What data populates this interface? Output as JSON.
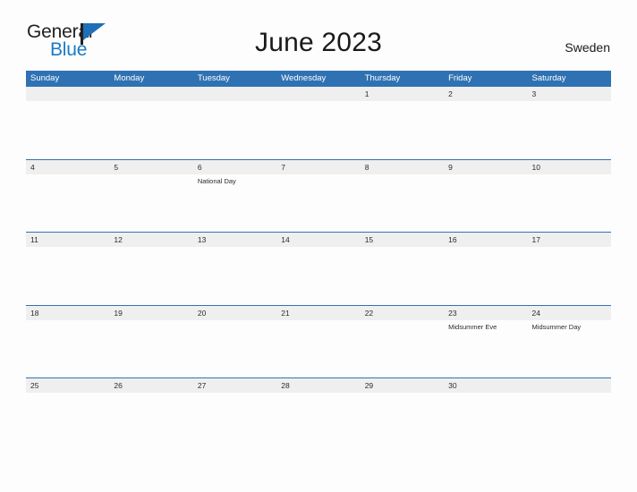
{
  "brand": {
    "name_part1": "General",
    "name_part2": "Blue",
    "flag_icon": "flag-icon",
    "accent_color": "#1e6fb8"
  },
  "header": {
    "title": "June 2023",
    "country": "Sweden"
  },
  "calendar": {
    "header_bg": "#2f72b3",
    "band_bg": "#efefef",
    "weekdays": [
      "Sunday",
      "Monday",
      "Tuesday",
      "Wednesday",
      "Thursday",
      "Friday",
      "Saturday"
    ],
    "weeks": [
      [
        {
          "day": "",
          "event": ""
        },
        {
          "day": "",
          "event": ""
        },
        {
          "day": "",
          "event": ""
        },
        {
          "day": "",
          "event": ""
        },
        {
          "day": "1",
          "event": ""
        },
        {
          "day": "2",
          "event": ""
        },
        {
          "day": "3",
          "event": ""
        }
      ],
      [
        {
          "day": "4",
          "event": ""
        },
        {
          "day": "5",
          "event": ""
        },
        {
          "day": "6",
          "event": "National Day"
        },
        {
          "day": "7",
          "event": ""
        },
        {
          "day": "8",
          "event": ""
        },
        {
          "day": "9",
          "event": ""
        },
        {
          "day": "10",
          "event": ""
        }
      ],
      [
        {
          "day": "11",
          "event": ""
        },
        {
          "day": "12",
          "event": ""
        },
        {
          "day": "13",
          "event": ""
        },
        {
          "day": "14",
          "event": ""
        },
        {
          "day": "15",
          "event": ""
        },
        {
          "day": "16",
          "event": ""
        },
        {
          "day": "17",
          "event": ""
        }
      ],
      [
        {
          "day": "18",
          "event": ""
        },
        {
          "day": "19",
          "event": ""
        },
        {
          "day": "20",
          "event": ""
        },
        {
          "day": "21",
          "event": ""
        },
        {
          "day": "22",
          "event": ""
        },
        {
          "day": "23",
          "event": "Midsummer Eve"
        },
        {
          "day": "24",
          "event": "Midsummer Day"
        }
      ],
      [
        {
          "day": "25",
          "event": ""
        },
        {
          "day": "26",
          "event": ""
        },
        {
          "day": "27",
          "event": ""
        },
        {
          "day": "28",
          "event": ""
        },
        {
          "day": "29",
          "event": ""
        },
        {
          "day": "30",
          "event": ""
        },
        {
          "day": "",
          "event": ""
        }
      ]
    ]
  }
}
